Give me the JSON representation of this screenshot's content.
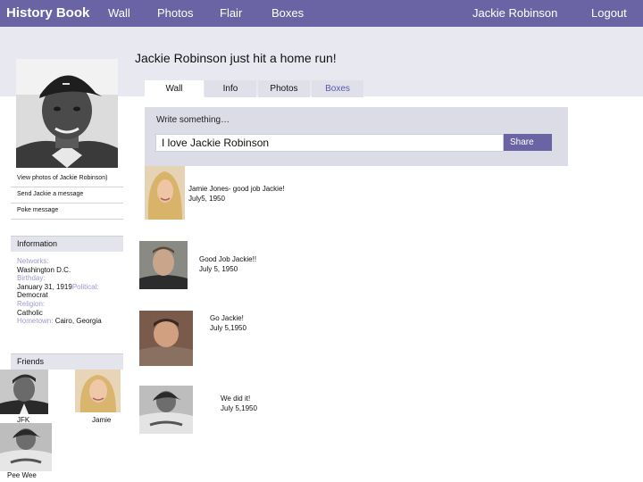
{
  "nav": {
    "brand": "History Book",
    "wall": "Wall",
    "photos": "Photos",
    "flair": "Flair",
    "boxes": "Boxes",
    "user": "Jackie Robinson",
    "logout": "Logout"
  },
  "colors": {
    "accent": "#6a64a4",
    "band": "#e8e8f0",
    "label": "#9a9acb"
  },
  "sidebar": {
    "links": [
      "View photos of Jackie Robinson)",
      "Send Jackie a message",
      "Poke message"
    ],
    "information_title": "Information",
    "info": {
      "networks_label": "Networks:",
      "networks": "Washington D.C.",
      "birthday_label": "Birthday:",
      "birthday": "January 31, 1919",
      "political_label": "Political:",
      "political": "Democrat",
      "religion_label": "Religion:",
      "religion": "Catholic",
      "hometown_label": "Hometown:",
      "hometown": "Cairo, Georgia"
    },
    "friends_title": "Friends",
    "friends": [
      "JFK",
      "Jamie",
      "Pee Wee"
    ]
  },
  "main": {
    "status": "Jackie Robinson just hit a home run!",
    "tabs": [
      "Wall",
      "Info",
      "Photos",
      "Boxes"
    ],
    "composer": {
      "label": "Write something…",
      "value": "I love Jackie Robinson",
      "share": "Share"
    },
    "posts": [
      {
        "line1": "Jamie Jones-  good job Jackie!",
        "line2": "July5, 1950"
      },
      {
        "line1": "Good Job Jackie!!",
        "line2": "July 5, 1950"
      },
      {
        "line1": "Go Jackie!",
        "line2": "July 5,1950"
      },
      {
        "line1": "We did it!",
        "line2": "July 5,1950"
      }
    ]
  }
}
